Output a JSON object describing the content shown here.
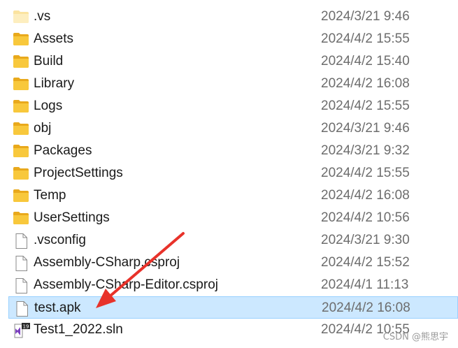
{
  "files": [
    {
      "name": ".vs",
      "date": "2024/3/21 9:46",
      "type": "folder-light",
      "icon": "folder-icon"
    },
    {
      "name": "Assets",
      "date": "2024/4/2 15:55",
      "type": "folder",
      "icon": "folder-icon"
    },
    {
      "name": "Build",
      "date": "2024/4/2 15:40",
      "type": "folder",
      "icon": "folder-icon"
    },
    {
      "name": "Library",
      "date": "2024/4/2 16:08",
      "type": "folder",
      "icon": "folder-icon"
    },
    {
      "name": "Logs",
      "date": "2024/4/2 15:55",
      "type": "folder",
      "icon": "folder-icon"
    },
    {
      "name": "obj",
      "date": "2024/3/21 9:46",
      "type": "folder",
      "icon": "folder-icon"
    },
    {
      "name": "Packages",
      "date": "2024/3/21 9:32",
      "type": "folder",
      "icon": "folder-icon"
    },
    {
      "name": "ProjectSettings",
      "date": "2024/4/2 15:55",
      "type": "folder",
      "icon": "folder-icon"
    },
    {
      "name": "Temp",
      "date": "2024/4/2 16:08",
      "type": "folder",
      "icon": "folder-icon"
    },
    {
      "name": "UserSettings",
      "date": "2024/4/2 10:56",
      "type": "folder",
      "icon": "folder-icon"
    },
    {
      "name": ".vsconfig",
      "date": "2024/3/21 9:30",
      "type": "file",
      "icon": "file-icon"
    },
    {
      "name": "Assembly-CSharp.csproj",
      "date": "2024/4/2 15:52",
      "type": "file",
      "icon": "file-icon"
    },
    {
      "name": "Assembly-CSharp-Editor.csproj",
      "date": "2024/4/1 11:13",
      "type": "file",
      "icon": "file-icon"
    },
    {
      "name": "test.apk",
      "date": "2024/4/2 16:08",
      "type": "file",
      "icon": "file-icon",
      "selected": true
    },
    {
      "name": "Test1_2022.sln",
      "date": "2024/4/2 10:55",
      "type": "sln",
      "icon": "visual-studio-solution-icon"
    }
  ],
  "sln_badge": "19",
  "watermark": "CSDN @熊思宇",
  "colors": {
    "selection": "#cce8ff",
    "selection_border": "#99d1ff",
    "folder": "#f8c83c",
    "arrow": "#e8322a"
  }
}
